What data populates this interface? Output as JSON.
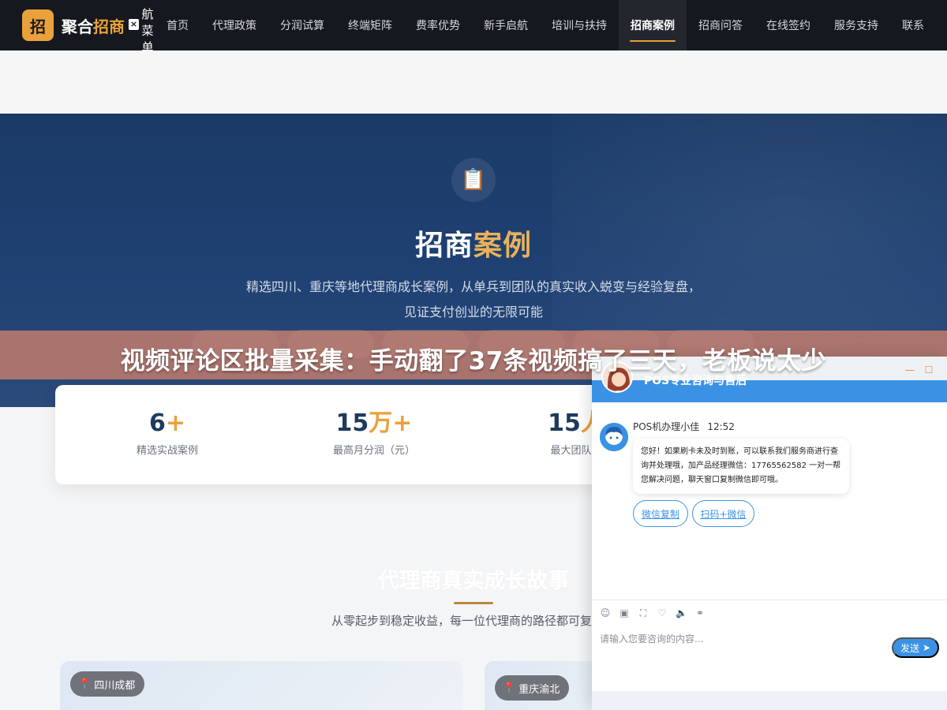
{
  "nav": {
    "logo_char": "招",
    "brand_main": "聚合",
    "brand_accent": "招商",
    "close_char": "×",
    "vertical_menu": [
      "航",
      "菜",
      "单"
    ],
    "items": [
      {
        "label": "首页"
      },
      {
        "label": "代理政策"
      },
      {
        "label": "分润试算"
      },
      {
        "label": "终端矩阵"
      },
      {
        "label": "费率优势"
      },
      {
        "label": "新手启航"
      },
      {
        "label": "培训与扶持"
      },
      {
        "label": "招商案例",
        "active": true
      },
      {
        "label": "招商问答"
      },
      {
        "label": "在线签约"
      },
      {
        "label": "服务支持"
      },
      {
        "label": "联系"
      }
    ]
  },
  "hero": {
    "icon": "📋",
    "title_main": "招商",
    "title_accent": "案例",
    "desc_line1": "精选四川、重庆等地代理商成长案例，从单兵到团队的真实收入蜕变与经验复盘，",
    "desc_line2": "见证支付创业的无限可能"
  },
  "stats": [
    {
      "num": "6",
      "unit": "+",
      "label": "精选实战案例"
    },
    {
      "num": "15",
      "unit": "万+",
      "label": "最高月分润（元）"
    },
    {
      "num": "15",
      "unit": "人",
      "label": "最大团队规"
    }
  ],
  "story": {
    "title": "代理商真实成长故事",
    "desc": "从零起步到稳定收益，每一位代理商的路径都可复制、",
    "cards": [
      {
        "location": "四川成都"
      },
      {
        "location": "重庆渝北"
      }
    ]
  },
  "banner": {
    "text": "视频评论区批量采集：手动翻了37条视频搞了三天，老板说太少"
  },
  "chat": {
    "title": "POS专业咨询与售后",
    "minimize": "—",
    "maximize": "☐",
    "agent_name": "POS机办理小佳",
    "time": "12:52",
    "message": "您好！如果刷卡未及时到账，可以联系我们服务商进行查询并处理哦，加产品经理微信：17765562582 一对一帮您解决问题，聊天窗口复制微信即可哦。",
    "quick_buttons": [
      "微信复制",
      "扫码+微信"
    ],
    "input_placeholder": "请输入您要咨询的内容...",
    "send_label": "发送",
    "tool_icons": [
      "emoji-icon",
      "image-icon",
      "screenshot-icon",
      "evaluate-icon",
      "voice-icon",
      "transfer-icon"
    ],
    "accent_color": "#3b92e4"
  },
  "colors": {
    "nav_bg": "#15181e",
    "brand_accent": "#e9a13b",
    "hero_bg": "#1f4173",
    "banner_bg": "#cc806c"
  }
}
